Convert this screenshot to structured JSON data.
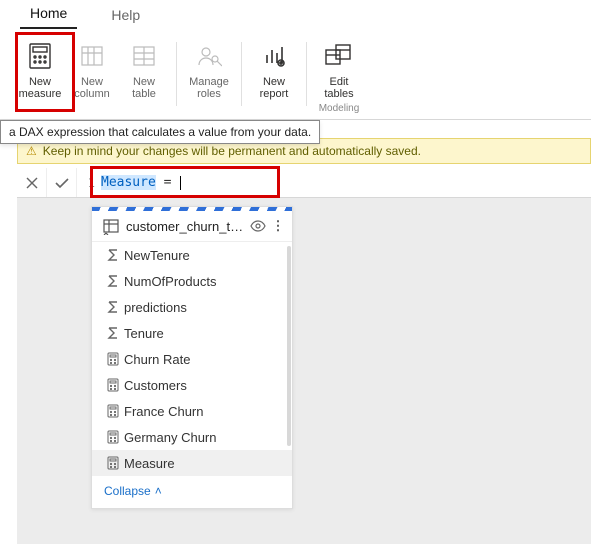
{
  "tabs": {
    "home": "Home",
    "help": "Help"
  },
  "ribbon": {
    "new_measure": "New\nmeasure",
    "new_column": "New\ncolumn",
    "new_table": "New\ntable",
    "manage_roles": "Manage\nroles",
    "new_report": "New\nreport",
    "edit_tables": "Edit\ntables",
    "group_modeling": "Modeling"
  },
  "tooltip": "a DAX expression that calculates a value from your data.",
  "warning": "Keep in mind your changes will be permanent and automatically saved.",
  "formula": {
    "lineno": "1",
    "selected": "Measure",
    "rest": " = "
  },
  "panel": {
    "title": "customer_churn_test_...",
    "fields": [
      {
        "icon": "sigma",
        "label": "NewTenure"
      },
      {
        "icon": "sigma",
        "label": "NumOfProducts"
      },
      {
        "icon": "sigma",
        "label": "predictions"
      },
      {
        "icon": "sigma",
        "label": "Tenure"
      },
      {
        "icon": "calc",
        "label": "Churn Rate"
      },
      {
        "icon": "calc",
        "label": "Customers"
      },
      {
        "icon": "calc",
        "label": "France Churn"
      },
      {
        "icon": "calc",
        "label": "Germany Churn"
      },
      {
        "icon": "calc",
        "label": "Measure",
        "hl": true
      }
    ],
    "collapse": "Collapse"
  }
}
